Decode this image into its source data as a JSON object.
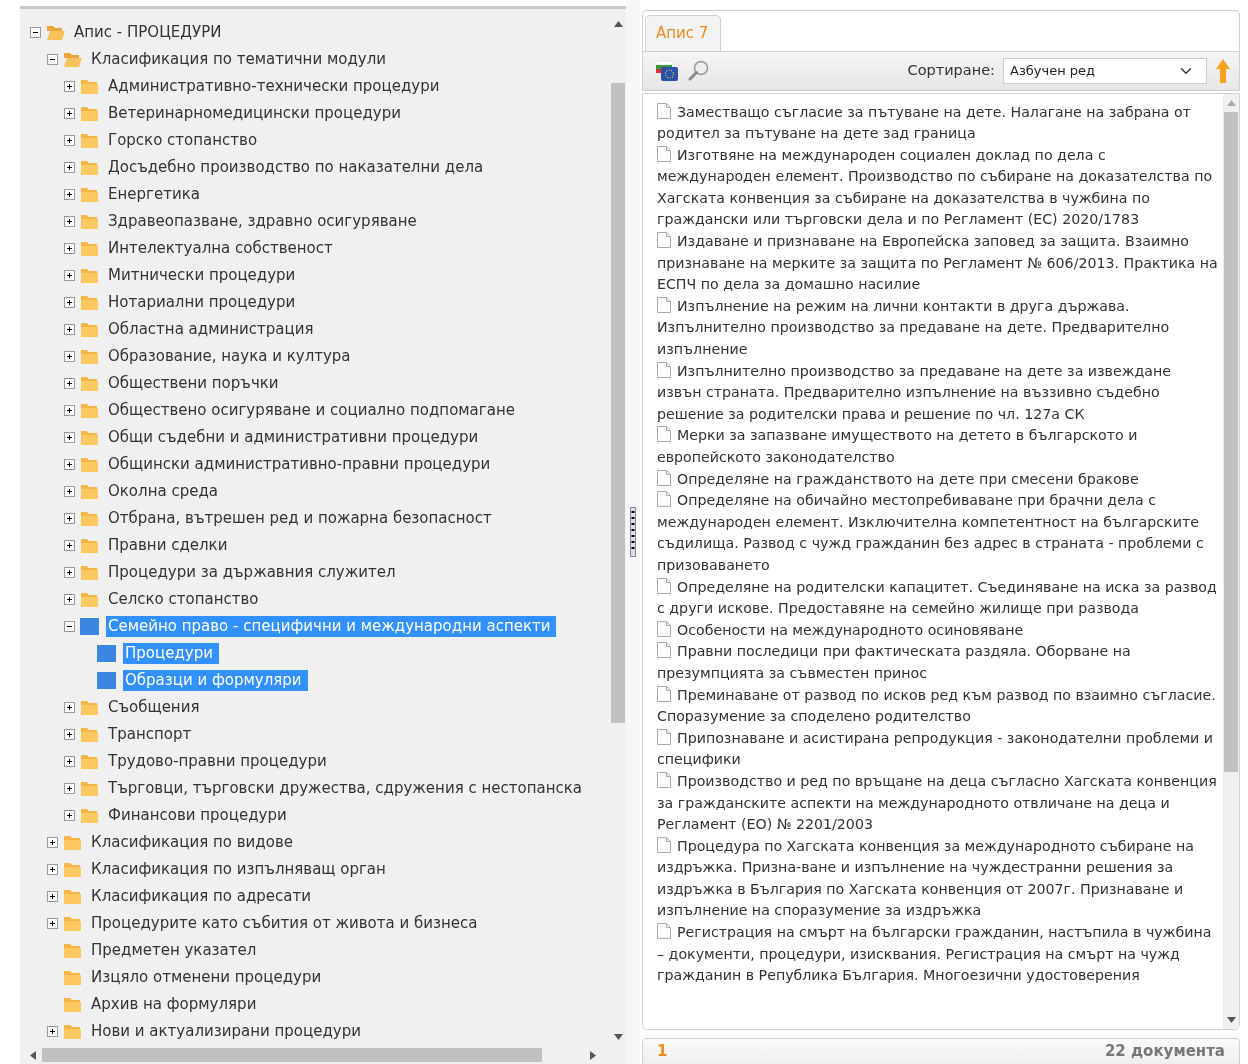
{
  "tree": [
    {
      "label": "Апис - ПРОЦЕДУРИ",
      "expanded": true,
      "selected": false,
      "children": [
        {
          "label": "Класификация по тематични модули",
          "expanded": true,
          "selected": false,
          "children": [
            {
              "label": "Административно-технически процедури",
              "expanded": false,
              "selected": false
            },
            {
              "label": "Ветеринарномедицински процедури",
              "expanded": false,
              "selected": false
            },
            {
              "label": "Горско стопанство",
              "expanded": false,
              "selected": false
            },
            {
              "label": "Досъдебно производство по наказателни дела",
              "expanded": false,
              "selected": false
            },
            {
              "label": "Енергетика",
              "expanded": false,
              "selected": false
            },
            {
              "label": "Здравеопазване, здравно осигуряване",
              "expanded": false,
              "selected": false
            },
            {
              "label": "Интелектуална собственост",
              "expanded": false,
              "selected": false
            },
            {
              "label": "Митнически процедури",
              "expanded": false,
              "selected": false
            },
            {
              "label": "Нотариални процедури",
              "expanded": false,
              "selected": false
            },
            {
              "label": "Областна администрация",
              "expanded": false,
              "selected": false
            },
            {
              "label": "Образование, наука и култура",
              "expanded": false,
              "selected": false
            },
            {
              "label": "Обществени поръчки",
              "expanded": false,
              "selected": false
            },
            {
              "label": "Обществено осигуряване и социално подпомагане",
              "expanded": false,
              "selected": false
            },
            {
              "label": "Общи съдебни и административни процедури",
              "expanded": false,
              "selected": false
            },
            {
              "label": "Общински административно-правни процедури",
              "expanded": false,
              "selected": false
            },
            {
              "label": "Околна среда",
              "expanded": false,
              "selected": false
            },
            {
              "label": "Отбрана, вътрешен ред и пожарна безопасност",
              "expanded": false,
              "selected": false
            },
            {
              "label": "Правни сделки",
              "expanded": false,
              "selected": false
            },
            {
              "label": "Процедури за държавния служител",
              "expanded": false,
              "selected": false
            },
            {
              "label": "Селско стопанство",
              "expanded": false,
              "selected": false
            },
            {
              "label": "Семейно право - специфични и международни аспекти",
              "expanded": true,
              "selected": true,
              "children": [
                {
                  "label": "Процедури",
                  "selected": true
                },
                {
                  "label": "Образци и формуляри",
                  "selected": true
                }
              ]
            },
            {
              "label": "Съобщения",
              "expanded": false,
              "selected": false
            },
            {
              "label": "Транспорт",
              "expanded": false,
              "selected": false
            },
            {
              "label": "Трудово-правни процедури",
              "expanded": false,
              "selected": false
            },
            {
              "label": "Търговци, търговски дружества, сдружения с нестопанска",
              "expanded": false,
              "selected": false
            },
            {
              "label": "Финансови процедури",
              "expanded": false,
              "selected": false
            }
          ]
        },
        {
          "label": "Класификация по видове",
          "expanded": false,
          "selected": false
        },
        {
          "label": "Класификация по изпълняващ орган",
          "expanded": false,
          "selected": false
        },
        {
          "label": "Класификация по адресати",
          "expanded": false,
          "selected": false
        },
        {
          "label": "Процедурите като събития от живота и бизнеса",
          "expanded": false,
          "selected": false
        },
        {
          "label": "Предметен указател",
          "selected": false
        },
        {
          "label": "Изцяло отменени процедури",
          "selected": false
        },
        {
          "label": "Архив на формуляри",
          "selected": false
        },
        {
          "label": "Нови и актуализирани процедури",
          "expanded": false,
          "selected": false
        }
      ]
    }
  ],
  "panel": {
    "tab": "Апис 7",
    "sort_label": "Сортиране:",
    "sort_value": "Азбучен ред",
    "documents": [
      "Заместващо съгласие за пътуване на дете. Налагане на забрана от родител за пътуване на дете зад граница",
      "Изготвяне на международен социален доклад по дела с международен елемент. Производство по събиране на доказателства по Хагската конвенция за събиране на доказателства в чужбина по граждански или търговски дела и по Регламент (ЕС) 2020/1783",
      "Издаване и признаване на Европейска заповед за защита. Взаимно признаване на мерките за защита по Регламент № 606/2013. Практика на ЕСПЧ по дела за домашно насилие",
      "Изпълнение на режим на лични контакти в друга държава. Изпълнително производство за предаване на дете. Предварително изпълнение",
      "Изпълнително производство за предаване на дете за извеждане извън страната. Предварително изпълнение на въззивно съдебно решение за родителски права и решение по чл. 127а СК",
      "Мерки за запазване имуществото на детето в българското и европейското законодателство",
      "Определяне на гражданството на дете при смесени бракове",
      "Определяне на обичайно местопребиваване при брачни дела с международен елемент. Изключителна компетентност на българските съдилища. Развод с чужд гражданин без адрес в страната - проблеми с призоваването",
      "Определяне на родителски капацитет. Съединяване на иска за развод с други искове. Предоставяне на семейно жилище при развода",
      "Особености на международното осиновяване",
      "Правни последици при фактическата раздяла. Оборване на презумпцията за съвместен принос",
      "Преминаване от развод по исков ред към развод по взаимно съгласие. Споразумение за споделено родителство",
      "Припознаване и асистирана репродукция - законодателни проблеми и специфики",
      "Производство и ред по връщане на деца съгласно Хагската конвенция за гражданските аспекти на международното отвличане на деца и Регламент (ЕО) № 2201/2003",
      "Процедура по Хагската конвенция за международното събиране на издръжка. Призна-ване и изпълнение на чуждестранни решения за издръжка в България по Хагската конвенция от 2007г. Признаване и изпълнение на споразумение за издръжка",
      "Регистрация на смърт на български гражданин, настъпила в чужбина – документи, процедури, изисквания. Регистрация на смърт на чужд гражданин в Република България. Многоезични удостоверения"
    ],
    "page": "1",
    "count": "22 документа"
  }
}
